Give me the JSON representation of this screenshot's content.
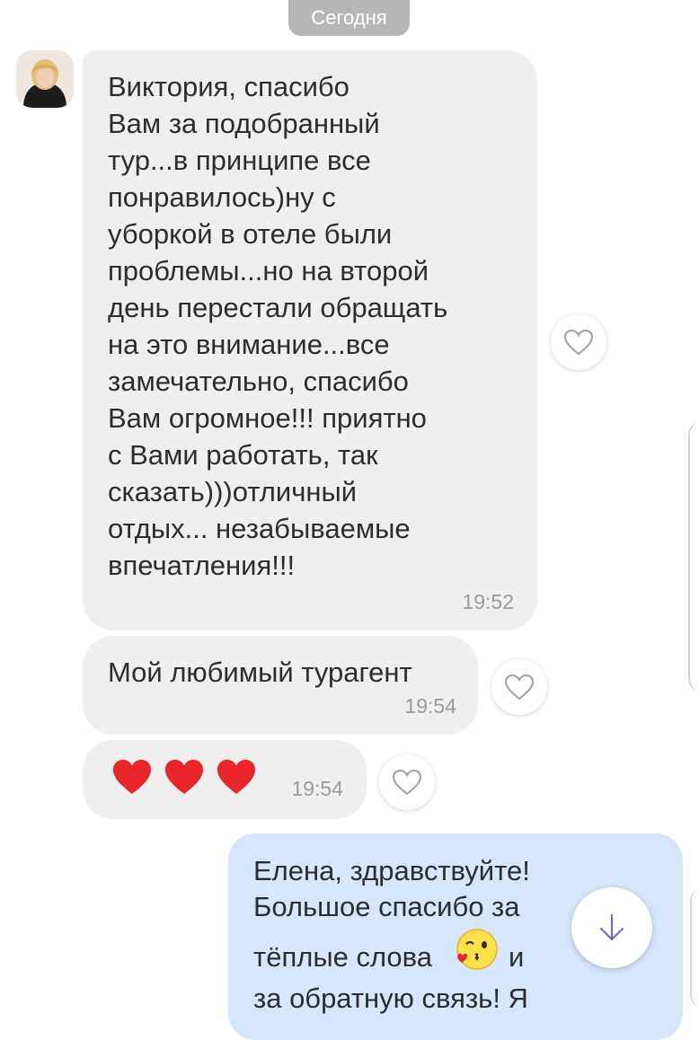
{
  "date_divider": "Сегодня",
  "contact": {
    "avatar_icon": "avatar-photo"
  },
  "messages": [
    {
      "text": "Виктория, спасибо\nВам за подобранный\nтур...в принципе все\nпонравилось)ну с\nуборкой в отеле были\nпроблемы...но на второй\nдень перестали обращать\nна это внимание...все\nзамечательно, спасибо\nВам огромное!!! приятно\nс Вами работать, так\nсказать)))отличный\nотдых... незабываемые\nвпечатления!!!",
      "time": "19:52"
    },
    {
      "text": "Мой любимый турагент",
      "time": "19:54"
    },
    {
      "emoji": [
        "red-heart",
        "red-heart",
        "red-heart"
      ],
      "time": "19:54"
    }
  ],
  "outgoing": {
    "line1": "Елена, здравствуйте!",
    "line2": "Большое спасибо за",
    "line3a": "тёплые слова",
    "line3b": "и",
    "line4": "за обратную связь! Я",
    "emoji": "blowing-kiss-face"
  },
  "icons": {
    "like": "heart-outline-icon",
    "scroll": "arrow-down-icon"
  },
  "colors": {
    "incoming_bubble": "#efefef",
    "outgoing_bubble": "#d7e7fb",
    "accent": "#7b68c8",
    "heart_red": "#e8262a"
  }
}
